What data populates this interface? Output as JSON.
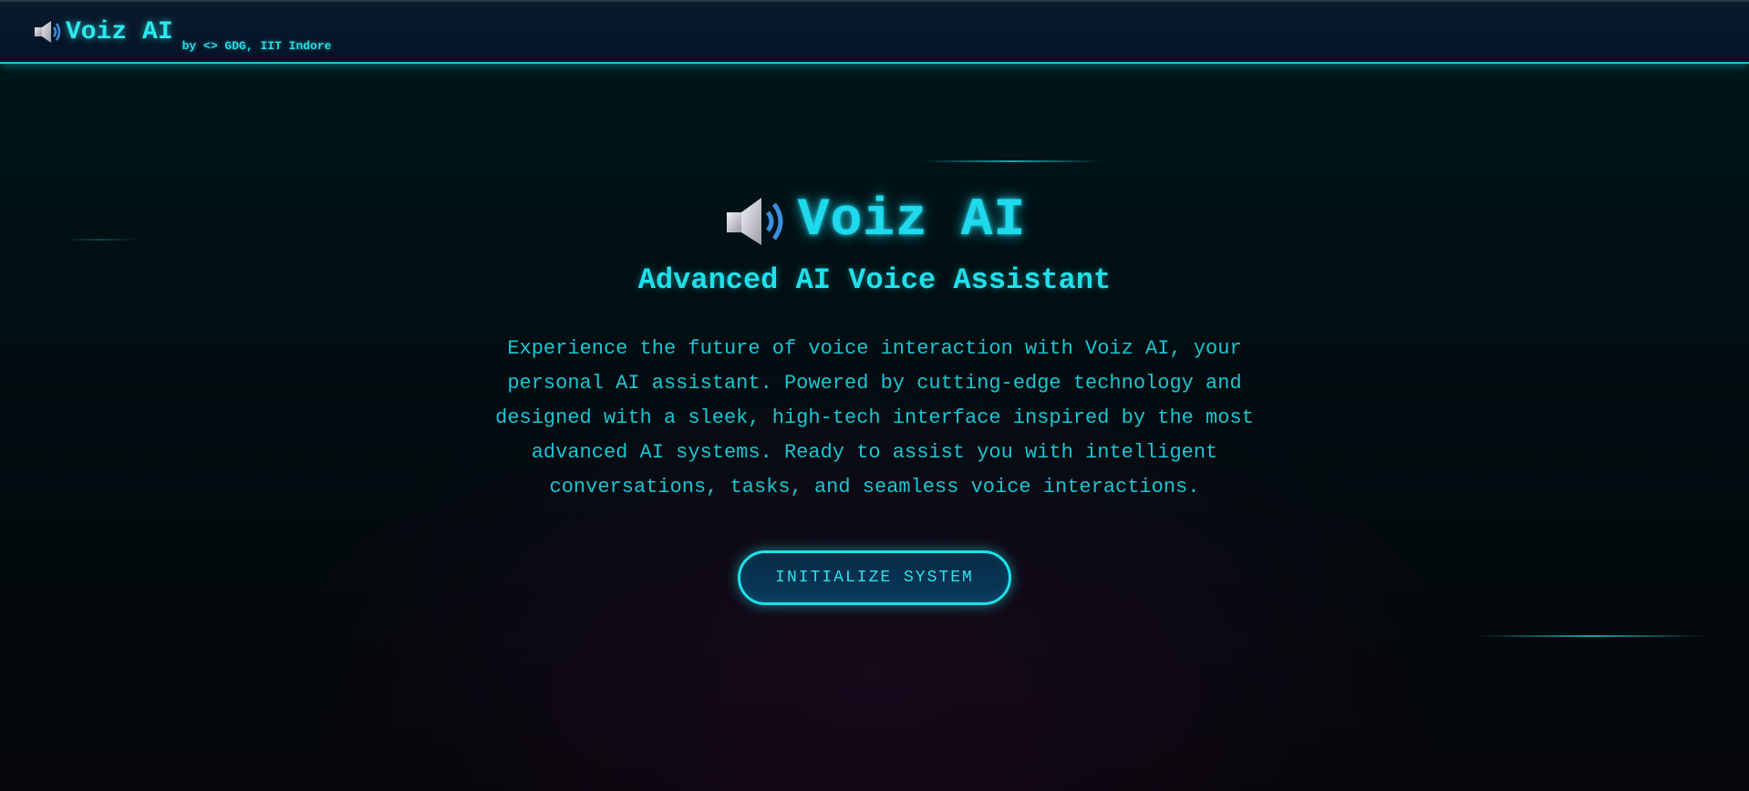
{
  "header": {
    "icon": "speaker-icon",
    "app_name": "Voiz AI",
    "byline": "by <> GDG, IIT Indore"
  },
  "hero": {
    "icon": "speaker-icon",
    "title": "Voiz AI",
    "subtitle": "Advanced AI Voice Assistant",
    "description": "Experience the future of voice interaction with Voiz AI, your personal AI assistant. Powered by cutting-edge technology and designed with a sleek, high-tech interface inspired by the most advanced AI systems. Ready to assist you with intelligent conversations, tasks, and seamless voice interactions.",
    "cta_label": "INITIALIZE SYSTEM"
  },
  "colors": {
    "accent": "#1fd9ec",
    "background": "#010e12",
    "header_bg": "#031426",
    "button_bg": "#0a3a5c"
  }
}
